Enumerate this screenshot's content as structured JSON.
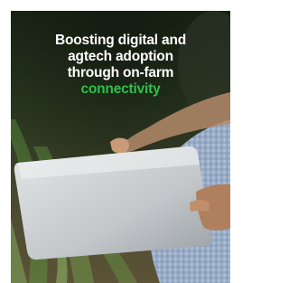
{
  "promo": {
    "headline_line_1": "Boosting digital and",
    "headline_line_2": "agtech adoption",
    "headline_line_3": "through on-farm",
    "headline_accent": "connectivity"
  },
  "colors": {
    "headline_text": "#ffffff",
    "accent_text": "#2fbf4a",
    "background_dark": "#1c2818",
    "crop_green": "#6fae4c",
    "shirt_blue": "#9fb4cf",
    "tablet_grey": "#c9cdd0"
  },
  "image": {
    "subject": "photo-farmer-tablet"
  }
}
